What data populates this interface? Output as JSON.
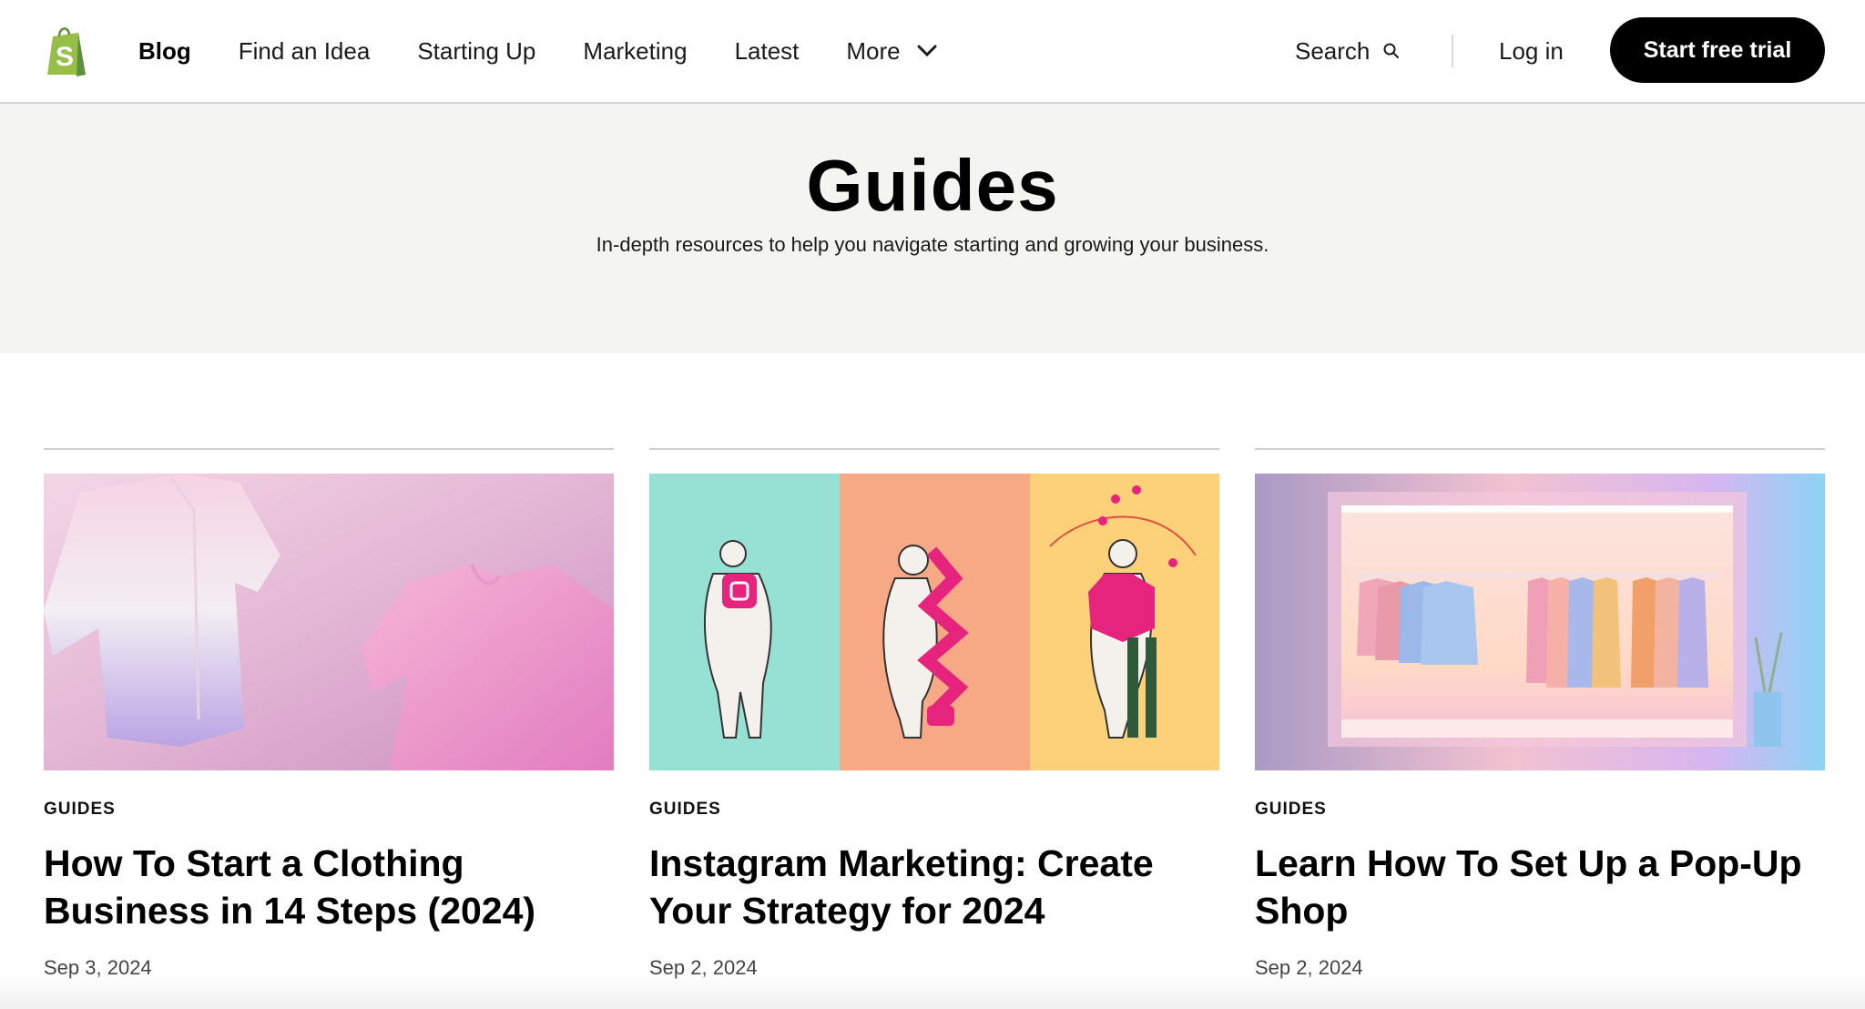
{
  "header": {
    "nav": [
      {
        "label": "Blog",
        "active": true
      },
      {
        "label": "Find an Idea"
      },
      {
        "label": "Starting Up"
      },
      {
        "label": "Marketing"
      },
      {
        "label": "Latest"
      },
      {
        "label": "More"
      }
    ],
    "search_label": "Search",
    "login_label": "Log in",
    "cta_label": "Start free trial",
    "colors": {
      "logo_green": "#95bf47",
      "logo_dark": "#5e8e3e",
      "cta_bg": "#000000"
    }
  },
  "hero": {
    "title": "Guides",
    "subtitle": "In-depth resources to help you navigate starting and growing your business."
  },
  "articles": [
    {
      "category": "GUIDES",
      "title": "How To Start a Clothing Business in 14 Steps (2024)",
      "date": "Sep 3, 2024"
    },
    {
      "category": "GUIDES",
      "title": "Instagram Marketing: Create Your Strategy for 2024",
      "date": "Sep 2, 2024"
    },
    {
      "category": "GUIDES",
      "title": "Learn How To Set Up a Pop-Up Shop",
      "date": "Sep 2, 2024"
    }
  ]
}
